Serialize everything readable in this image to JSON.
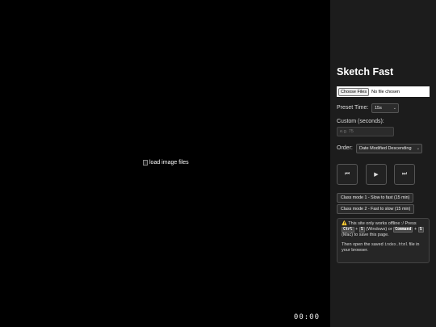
{
  "viewer": {
    "broken_image_alt": "load image files",
    "timer": "00:00"
  },
  "panel": {
    "title": "Sketch Fast",
    "file_button": "Choose Files",
    "file_status": "No file chosen",
    "preset_label": "Preset Time:",
    "preset_value": "15s",
    "custom_label": "Custom (seconds):",
    "custom_placeholder": "e.g. 75",
    "order_label": "Order:",
    "order_value": "Date Modified Descending",
    "prev_icon": "⏮",
    "play_icon": "▶",
    "next_icon": "⏭",
    "class_mode_1": "Class mode 1 - Slow to fast (15 min)",
    "class_mode_2": "Class mode 2 - Fast to slow (15 min)",
    "notice": {
      "warn_icon": "⚠️",
      "line1": "This site only works offline :/",
      "press": "Press",
      "ctrl": "Ctrl",
      "plus1": "+",
      "s1": "S",
      "windows": "(Windows) or",
      "command": "Command",
      "plus2": "+",
      "s2": "S",
      "mac": "(Mac) to save this page.",
      "then_open": "Then open the saved",
      "filename": "index.html",
      "in_browser": "file in your browser."
    }
  }
}
